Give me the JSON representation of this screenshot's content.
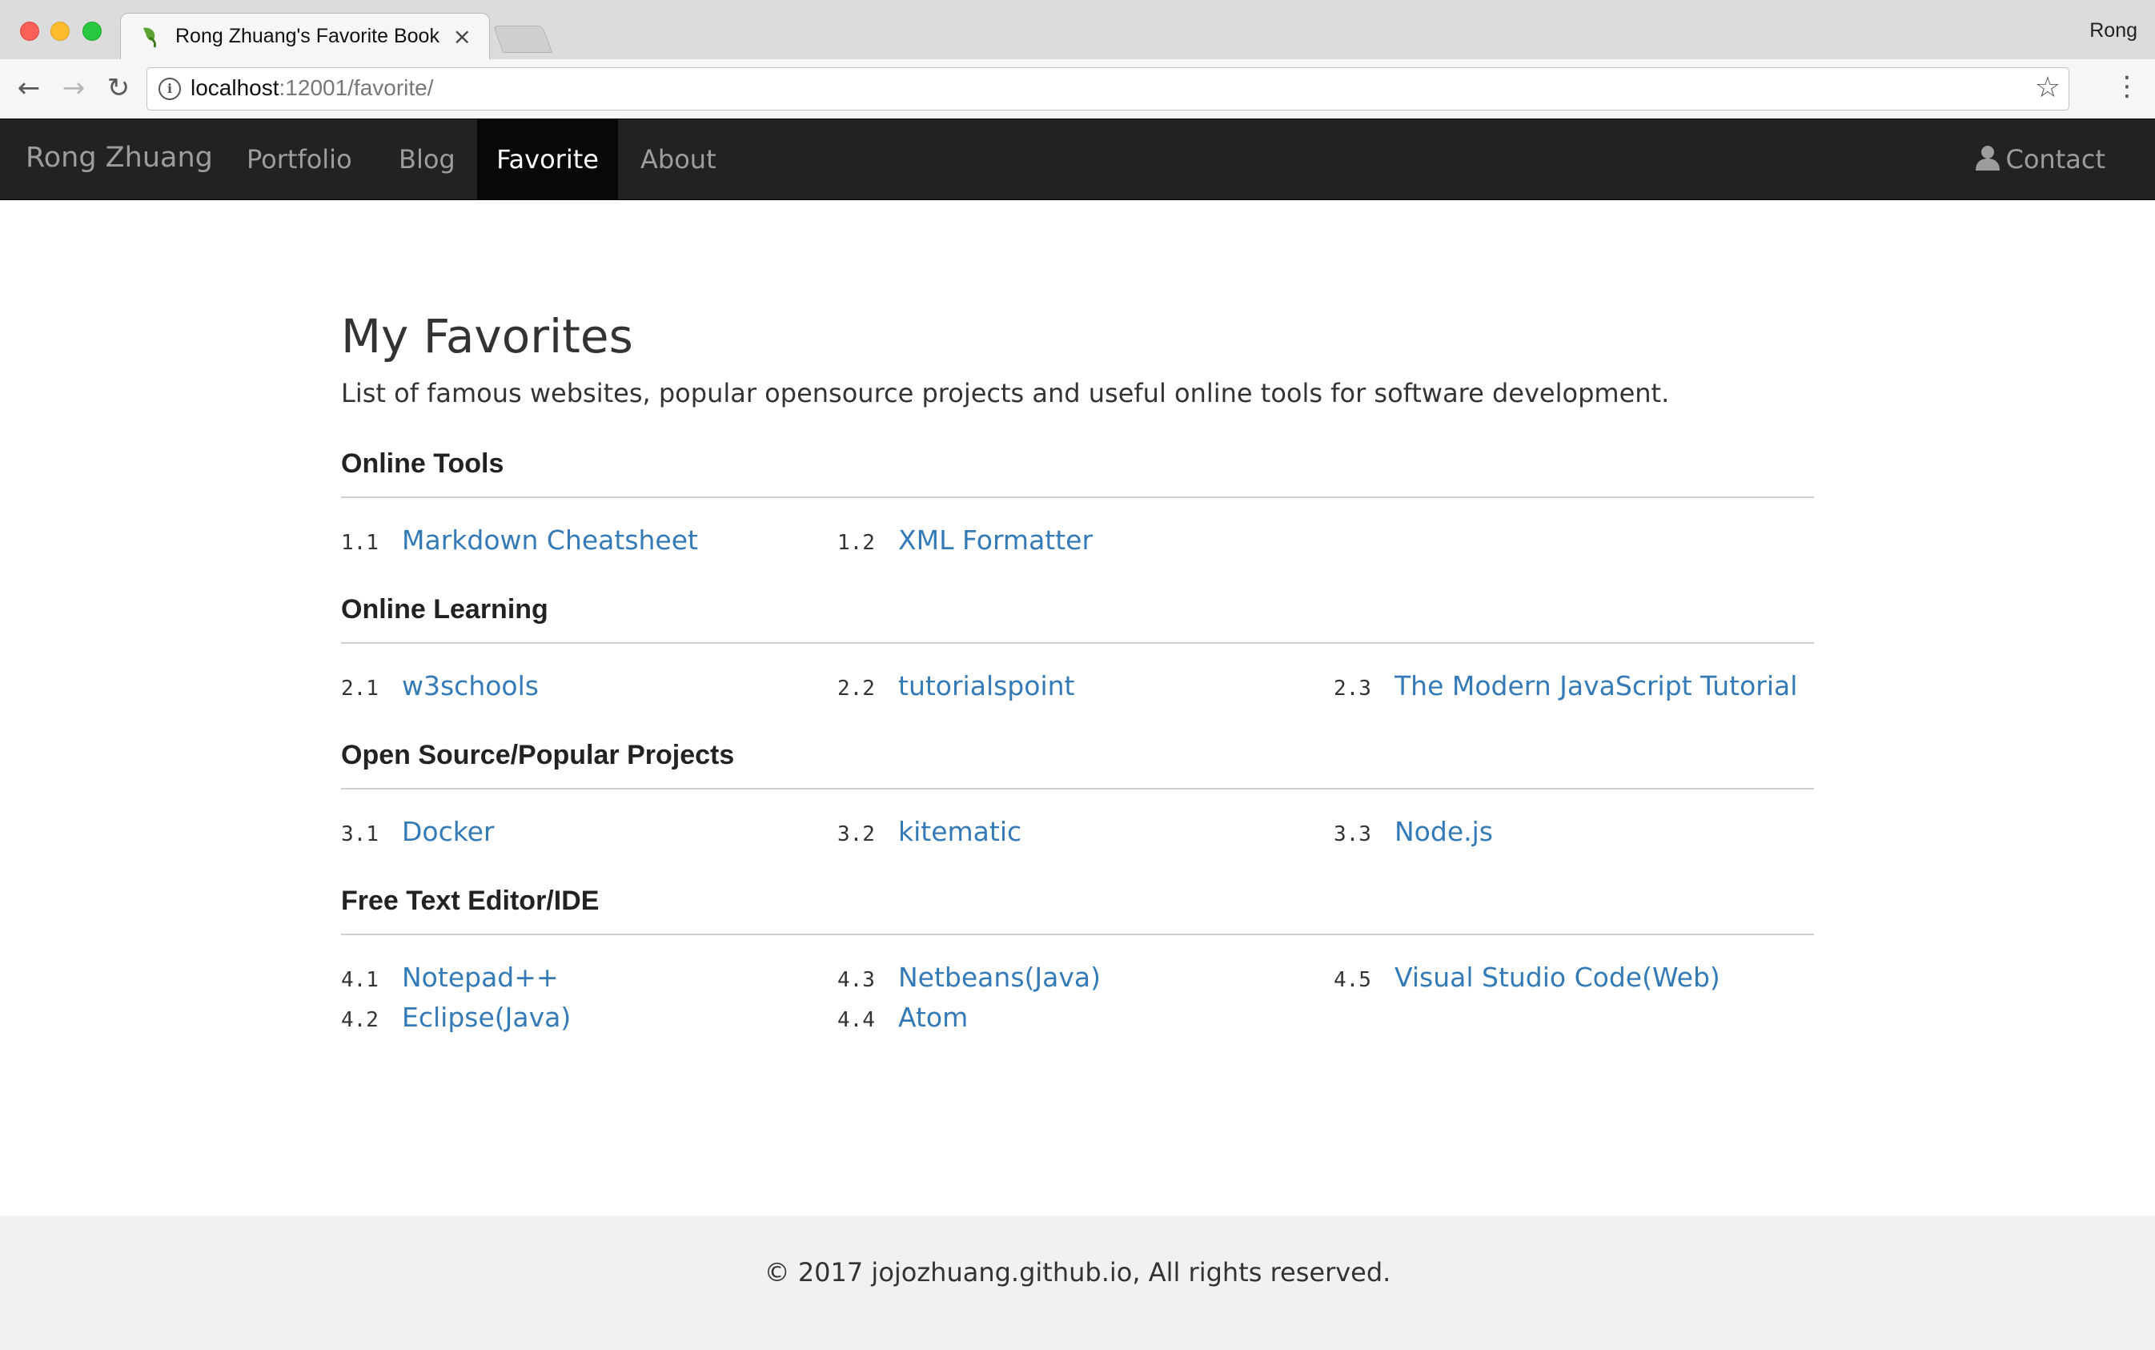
{
  "browser": {
    "tab_title": "Rong Zhuang's Favorite Bookmarks",
    "profile_name": "Rong",
    "url_host": "localhost",
    "url_path": ":12001/favorite/"
  },
  "nav": {
    "brand": "Rong Zhuang",
    "items": [
      {
        "label": "Portfolio"
      },
      {
        "label": "Blog"
      },
      {
        "label": "Favorite"
      },
      {
        "label": "About"
      }
    ],
    "contact": "Contact"
  },
  "page": {
    "title": "My Favorites",
    "lead": "List of famous websites, popular opensource projects and useful online tools for software development."
  },
  "sections": [
    {
      "title": "Online Tools",
      "columns": [
        [
          {
            "num": "1.1",
            "label": "Markdown Cheatsheet"
          }
        ],
        [
          {
            "num": "1.2",
            "label": "XML Formatter"
          }
        ],
        []
      ]
    },
    {
      "title": "Online Learning",
      "columns": [
        [
          {
            "num": "2.1",
            "label": "w3schools"
          }
        ],
        [
          {
            "num": "2.2",
            "label": "tutorialspoint"
          }
        ],
        [
          {
            "num": "2.3",
            "label": "The Modern JavaScript Tutorial"
          }
        ]
      ]
    },
    {
      "title": "Open Source/Popular Projects",
      "columns": [
        [
          {
            "num": "3.1",
            "label": "Docker"
          }
        ],
        [
          {
            "num": "3.2",
            "label": "kitematic"
          }
        ],
        [
          {
            "num": "3.3",
            "label": "Node.js"
          }
        ]
      ]
    },
    {
      "title": "Free Text Editor/IDE",
      "columns": [
        [
          {
            "num": "4.1",
            "label": "Notepad++"
          },
          {
            "num": "4.2",
            "label": "Eclipse(Java)"
          }
        ],
        [
          {
            "num": "4.3",
            "label": "Netbeans(Java)"
          },
          {
            "num": "4.4",
            "label": "Atom"
          }
        ],
        [
          {
            "num": "4.5",
            "label": "Visual Studio Code(Web)"
          }
        ]
      ]
    }
  ],
  "footer": {
    "text": "© 2017 jojozhuang.github.io, All rights reserved."
  },
  "colors": {
    "navbar_bg": "#222222",
    "navbar_active_bg": "#080808",
    "link": "#337ab7",
    "footer_bg": "#f1f1f1"
  },
  "icons": {
    "favicon": "leaf-icon",
    "contact": "user-icon"
  }
}
